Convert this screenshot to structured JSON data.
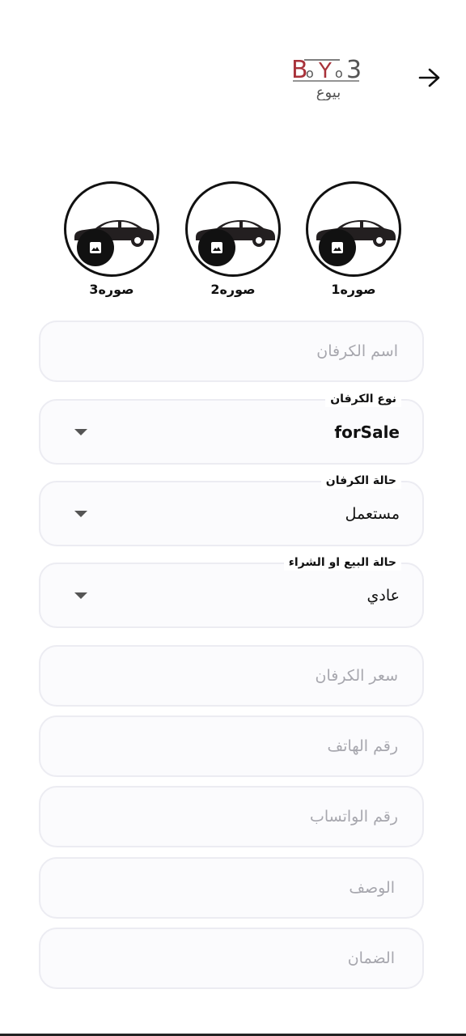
{
  "header": {
    "logo_text_latin": "BOYO3",
    "logo_text_arabic": "بيوع"
  },
  "photos": [
    {
      "label": "صوره1"
    },
    {
      "label": "صوره2"
    },
    {
      "label": "صوره3"
    }
  ],
  "form": {
    "caravan_name": {
      "placeholder": "اسم الكرفان"
    },
    "caravan_type": {
      "label": "نوع الكرفان",
      "value": "forSale"
    },
    "caravan_condition": {
      "label": "حالة الكرفان",
      "value": "مستعمل"
    },
    "sale_status": {
      "label": "حالة البيع او الشراء",
      "value": "عادي"
    },
    "caravan_price": {
      "placeholder": "سعر الكرفان"
    },
    "phone_number": {
      "placeholder": "رقم الهاتف"
    },
    "whatsapp_number": {
      "placeholder": "رقم الواتساب"
    },
    "description": {
      "placeholder": "الوصف"
    },
    "warranty": {
      "placeholder": "الضمان"
    }
  },
  "colors": {
    "logo_red": "#a8323a",
    "logo_gray": "#555555",
    "field_border": "#ececf2",
    "placeholder": "#a7a7ae"
  }
}
